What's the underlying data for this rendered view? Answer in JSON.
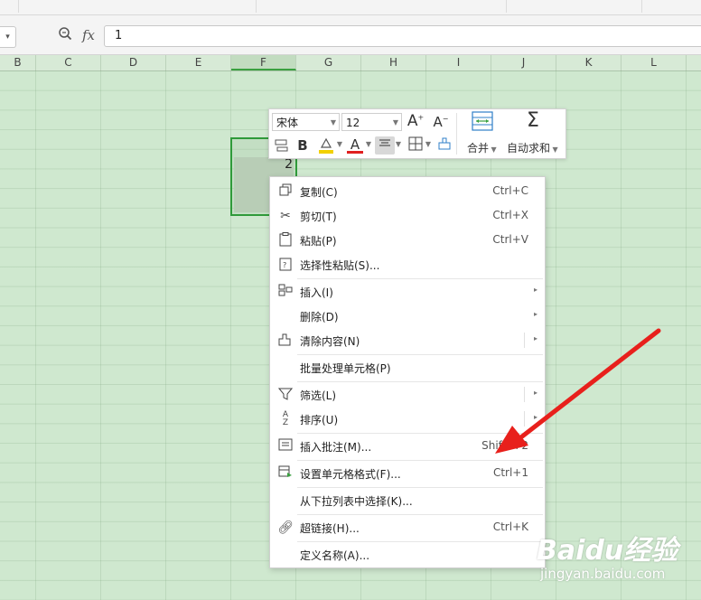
{
  "formula_bar": {
    "zoom_icon": "zoom-magnifier-icon",
    "fx_label": "fx",
    "value": "1"
  },
  "columns": [
    "B",
    "C",
    "D",
    "E",
    "F",
    "G",
    "H",
    "I",
    "J",
    "K",
    "L"
  ],
  "active_column": "F",
  "cell": {
    "value": "2"
  },
  "mini_toolbar": {
    "font_name": "宋体",
    "font_size": "12",
    "grow_font": "A",
    "shrink_font": "A",
    "bold": "B",
    "font_color": "A",
    "merge_label": "合并",
    "autosum_label": "自动求和"
  },
  "context_menu": {
    "items": [
      {
        "label": "复制(C)",
        "shortcut": "Ctrl+C",
        "icon": "copy-icon"
      },
      {
        "label": "剪切(T)",
        "shortcut": "Ctrl+X",
        "icon": "cut-icon"
      },
      {
        "label": "粘贴(P)",
        "shortcut": "Ctrl+V",
        "icon": "paste-icon"
      },
      {
        "label": "选择性粘贴(S)...",
        "shortcut": "",
        "icon": "paste-special-icon"
      },
      {
        "label": "插入(I)",
        "shortcut": "",
        "icon": "insert-icon"
      },
      {
        "label": "删除(D)",
        "shortcut": "",
        "icon": ""
      },
      {
        "label": "清除内容(N)",
        "shortcut": "",
        "icon": "clear-icon"
      },
      {
        "label": "批量处理单元格(P)",
        "shortcut": "",
        "icon": ""
      },
      {
        "label": "筛选(L)",
        "shortcut": "",
        "icon": "filter-icon"
      },
      {
        "label": "排序(U)",
        "shortcut": "",
        "icon": "sort-icon"
      },
      {
        "label": "插入批注(M)...",
        "shortcut": "Shift+F2",
        "icon": "comment-icon"
      },
      {
        "label": "设置单元格格式(F)...",
        "shortcut": "Ctrl+1",
        "icon": "format-cells-icon"
      },
      {
        "label": "从下拉列表中选择(K)...",
        "shortcut": "",
        "icon": ""
      },
      {
        "label": "超链接(H)...",
        "shortcut": "Ctrl+K",
        "icon": "link-icon"
      },
      {
        "label": "定义名称(A)...",
        "shortcut": "",
        "icon": ""
      }
    ]
  },
  "annotation": {
    "color": "#e8201c"
  },
  "watermark": {
    "brand": "Baidu经验",
    "url": "jingyan.baidu.com"
  },
  "colors": {
    "grid_bg": "#cfe8cf",
    "selection": "#2f9a3a"
  }
}
